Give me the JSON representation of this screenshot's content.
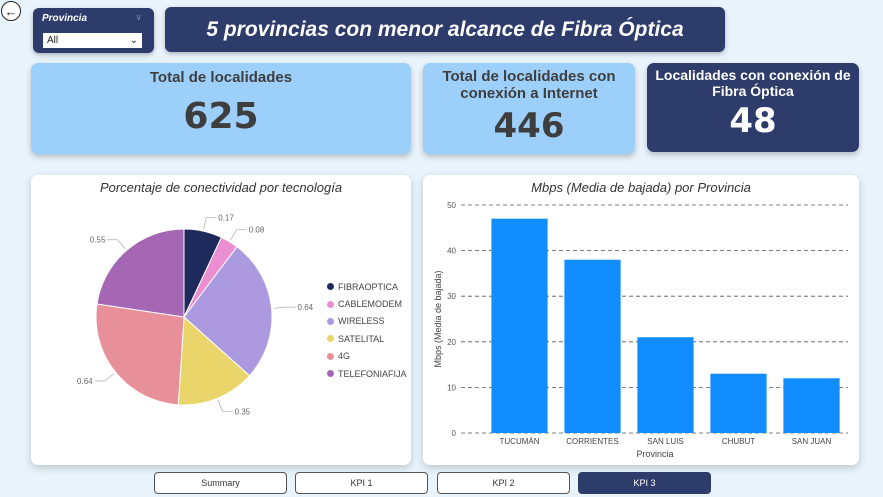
{
  "back_icon": "arrow-left-icon",
  "slicer": {
    "title": "Provincia",
    "value": "All"
  },
  "page_title": "5 provincias con menor alcance de Fibra Óptica",
  "kpis": [
    {
      "label": "Total de localidades",
      "value": "625"
    },
    {
      "label": "Total de localidades con conexión a Internet",
      "value": "446"
    },
    {
      "label": "Localidades con conexión de Fibra Óptica",
      "value": "48"
    }
  ],
  "colors": {
    "brand_dark": "#2e3c6b",
    "kpi_light": "#9dcffb",
    "bar": "#118dff",
    "background": "#e8f3fb"
  },
  "tabs": [
    {
      "label": "Summary",
      "active": false
    },
    {
      "label": "KPI 1",
      "active": false
    },
    {
      "label": "KPI 2",
      "active": false
    },
    {
      "label": "KPI 3",
      "active": true
    }
  ],
  "chart_data": [
    {
      "type": "pie",
      "title": "Porcentaje de conectividad por tecnología",
      "legend_position": "right",
      "slices": [
        {
          "name": "FIBRAOPTICA",
          "value": 0.17,
          "color": "#1f2a5c"
        },
        {
          "name": "CABLEMODEM",
          "value": 0.08,
          "color": "#ec8fd2"
        },
        {
          "name": "WIRELESS",
          "value": 0.64,
          "color": "#ab9ae0"
        },
        {
          "name": "SATELITAL",
          "value": 0.35,
          "color": "#ead56b"
        },
        {
          "name": "4G",
          "value": 0.64,
          "color": "#e8909a"
        },
        {
          "name": "TELEFONIAFIJA",
          "value": 0.55,
          "color": "#a566b4"
        }
      ]
    },
    {
      "type": "bar",
      "title": "Mbps (Media de bajada) por Provincia",
      "xlabel": "Provincia",
      "ylabel": "Mbps (Media de bajada)",
      "ylim": [
        0,
        50
      ],
      "yticks": [
        0,
        10,
        20,
        30,
        40,
        50
      ],
      "grid": true,
      "categories": [
        "TUCUMÁN",
        "CORRIENTES",
        "SAN LUIS",
        "CHUBUT",
        "SAN JUAN"
      ],
      "values": [
        47,
        38,
        21,
        13,
        12
      ],
      "color": "#118dff"
    }
  ]
}
